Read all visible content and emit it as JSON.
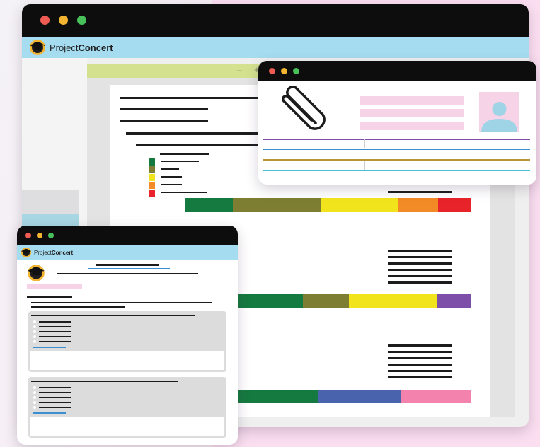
{
  "brand": {
    "name_prefix": "Project",
    "name_suffix": "Concert",
    "icon": "graduation-cap-icon"
  },
  "colors": {
    "titlebar": "#0d0d0d",
    "brand_bar": "#a6dcf0",
    "doc_header": "#d4e28f",
    "pink_block": "#f6d3e6",
    "traffic": [
      "#ee5b52",
      "#f3b431",
      "#48c15a"
    ]
  },
  "document": {
    "window_controls": [
      "–",
      "+"
    ],
    "legend_colors": [
      "#157a3f",
      "#7e7e33",
      "#f1e31c",
      "#f28a25",
      "#e8232a"
    ]
  },
  "bars": {
    "bar1": [
      {
        "color": "#157a3f",
        "pct": 16.7
      },
      {
        "color": "#7e7e33",
        "pct": 30.8
      },
      {
        "color": "#f1e31c",
        "pct": 27.1
      },
      {
        "color": "#f28a25",
        "pct": 13.8
      },
      {
        "color": "#e8232a",
        "pct": 11.6
      }
    ],
    "bar2": [
      {
        "color": "#157a3f",
        "pct": 29.1
      },
      {
        "color": "#7e7e33",
        "pct": 19.4
      },
      {
        "color": "#f1e31c",
        "pct": 37.0
      },
      {
        "color": "#7e4fa8",
        "pct": 14.5
      }
    ],
    "bar3": [
      {
        "color": "#157a3f",
        "pct": 35.5
      },
      {
        "color": "#4a63ad",
        "pct": 34.8
      },
      {
        "color": "#f382ac",
        "pct": 29.7
      }
    ]
  },
  "card": {
    "icon": "paperclip-icon",
    "avatar": "person-avatar-icon",
    "rule_colors": [
      "#7e4fa8",
      "#3b8fd0",
      "#b99436",
      "#49bfd6"
    ]
  },
  "mobile": {
    "question_boxes": 2
  }
}
